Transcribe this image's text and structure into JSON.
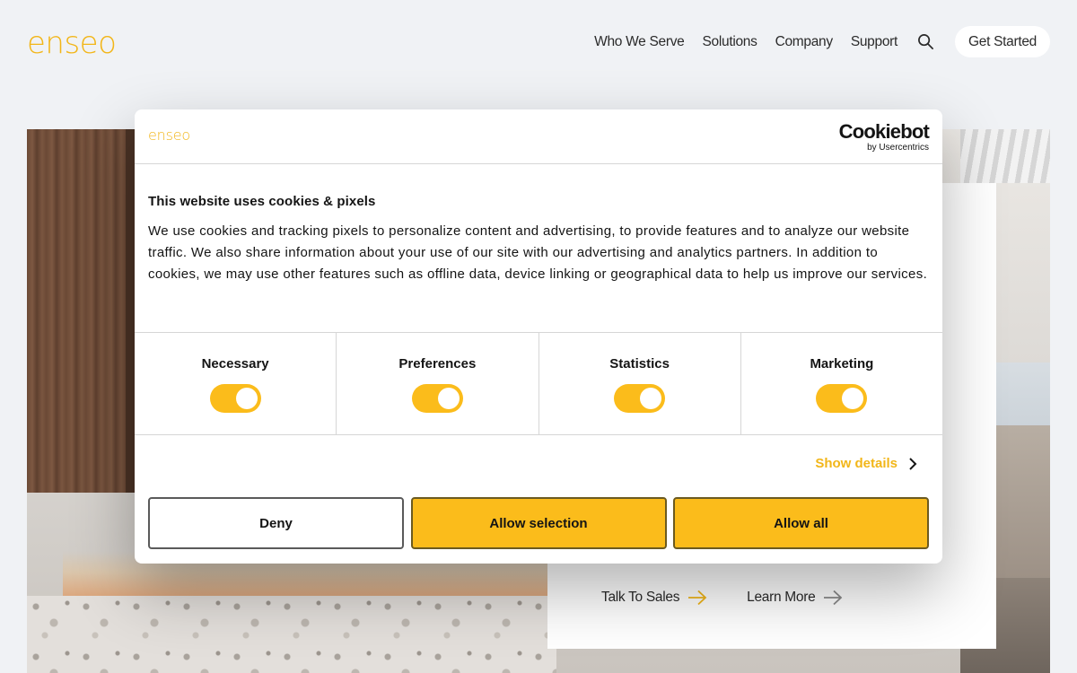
{
  "header": {
    "logo": "enseo",
    "nav": [
      "Who We Serve",
      "Solutions",
      "Company",
      "Support"
    ],
    "cta": "Get Started"
  },
  "hero": {
    "talk_to_sales": "Talk To Sales",
    "learn_more": "Learn More"
  },
  "cookie_dialog": {
    "logo": "enseo",
    "brand": "Cookiebot",
    "brand_sub": "by Usercentrics",
    "title": "This website uses cookies & pixels",
    "body": "We use cookies and tracking pixels to personalize content and advertising, to provide features and to analyze our website traffic. We also share information about your use of our site with our advertising and analytics partners. In addition to cookies, we may use other features such as offline data, device linking or geographical data to help us improve our services.",
    "toggles": [
      {
        "label": "Necessary",
        "on": true
      },
      {
        "label": "Preferences",
        "on": true
      },
      {
        "label": "Statistics",
        "on": true
      },
      {
        "label": "Marketing",
        "on": true
      }
    ],
    "show_details": "Show details",
    "buttons": {
      "deny": "Deny",
      "allow_selection": "Allow selection",
      "allow_all": "Allow all"
    }
  },
  "colors": {
    "brand_yellow": "#f2b619",
    "toggle_yellow": "#fbbc1b",
    "text_dark": "#141414"
  }
}
